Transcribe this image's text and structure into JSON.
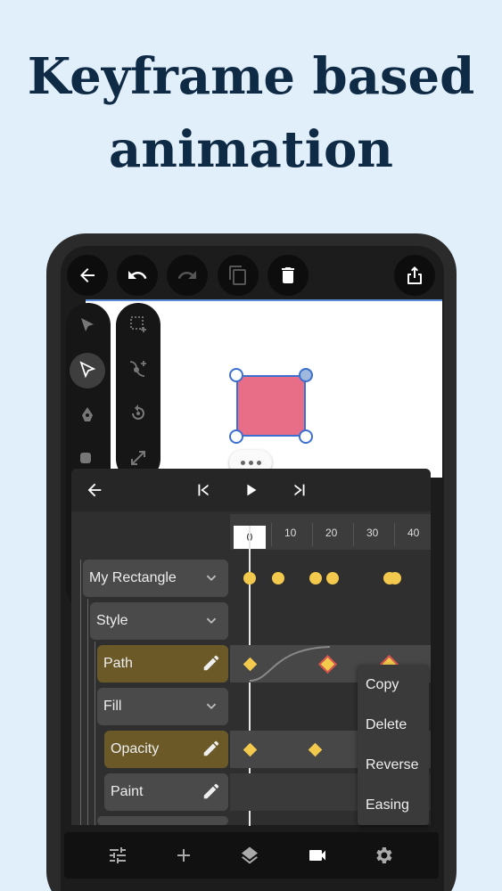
{
  "headline": {
    "line1": "Keyframe based",
    "line2": "animation"
  },
  "toolbar": {
    "icons": [
      "back-arrow-icon",
      "undo-icon",
      "redo-icon",
      "duplicate-icon",
      "delete-icon",
      "share-icon"
    ]
  },
  "tools": {
    "left": [
      "select-icon",
      "direct-select-icon",
      "pen-icon",
      "shape-icon"
    ],
    "right": [
      "marquee-add-icon",
      "node-add-icon",
      "rotate-icon",
      "scale-icon"
    ]
  },
  "timeline": {
    "ticks": [
      "10",
      "20",
      "30",
      "40"
    ],
    "current_frame": "0",
    "rows": [
      {
        "label": "My Rectangle",
        "icon": "chevron-down-icon",
        "highlight": false
      },
      {
        "label": "Style",
        "icon": "chevron-down-icon",
        "highlight": false
      },
      {
        "label": "Path",
        "icon": "edit-icon",
        "highlight": true
      },
      {
        "label": "Fill",
        "icon": "chevron-down-icon",
        "highlight": false
      },
      {
        "label": "Opacity",
        "icon": "edit-icon",
        "highlight": true
      },
      {
        "label": "Paint",
        "icon": "edit-icon",
        "highlight": false
      }
    ]
  },
  "context_menu": {
    "items": [
      "Copy",
      "Delete",
      "Reverse",
      "Easing"
    ]
  },
  "bottom_nav": {
    "icons": [
      "adjust-icon",
      "add-icon",
      "layers-icon",
      "video-icon",
      "settings-icon"
    ]
  },
  "colors": {
    "accent": "#f2c94c",
    "shape_fill": "#e86d87",
    "headline": "#0f2a44",
    "background": "#e1effb"
  }
}
